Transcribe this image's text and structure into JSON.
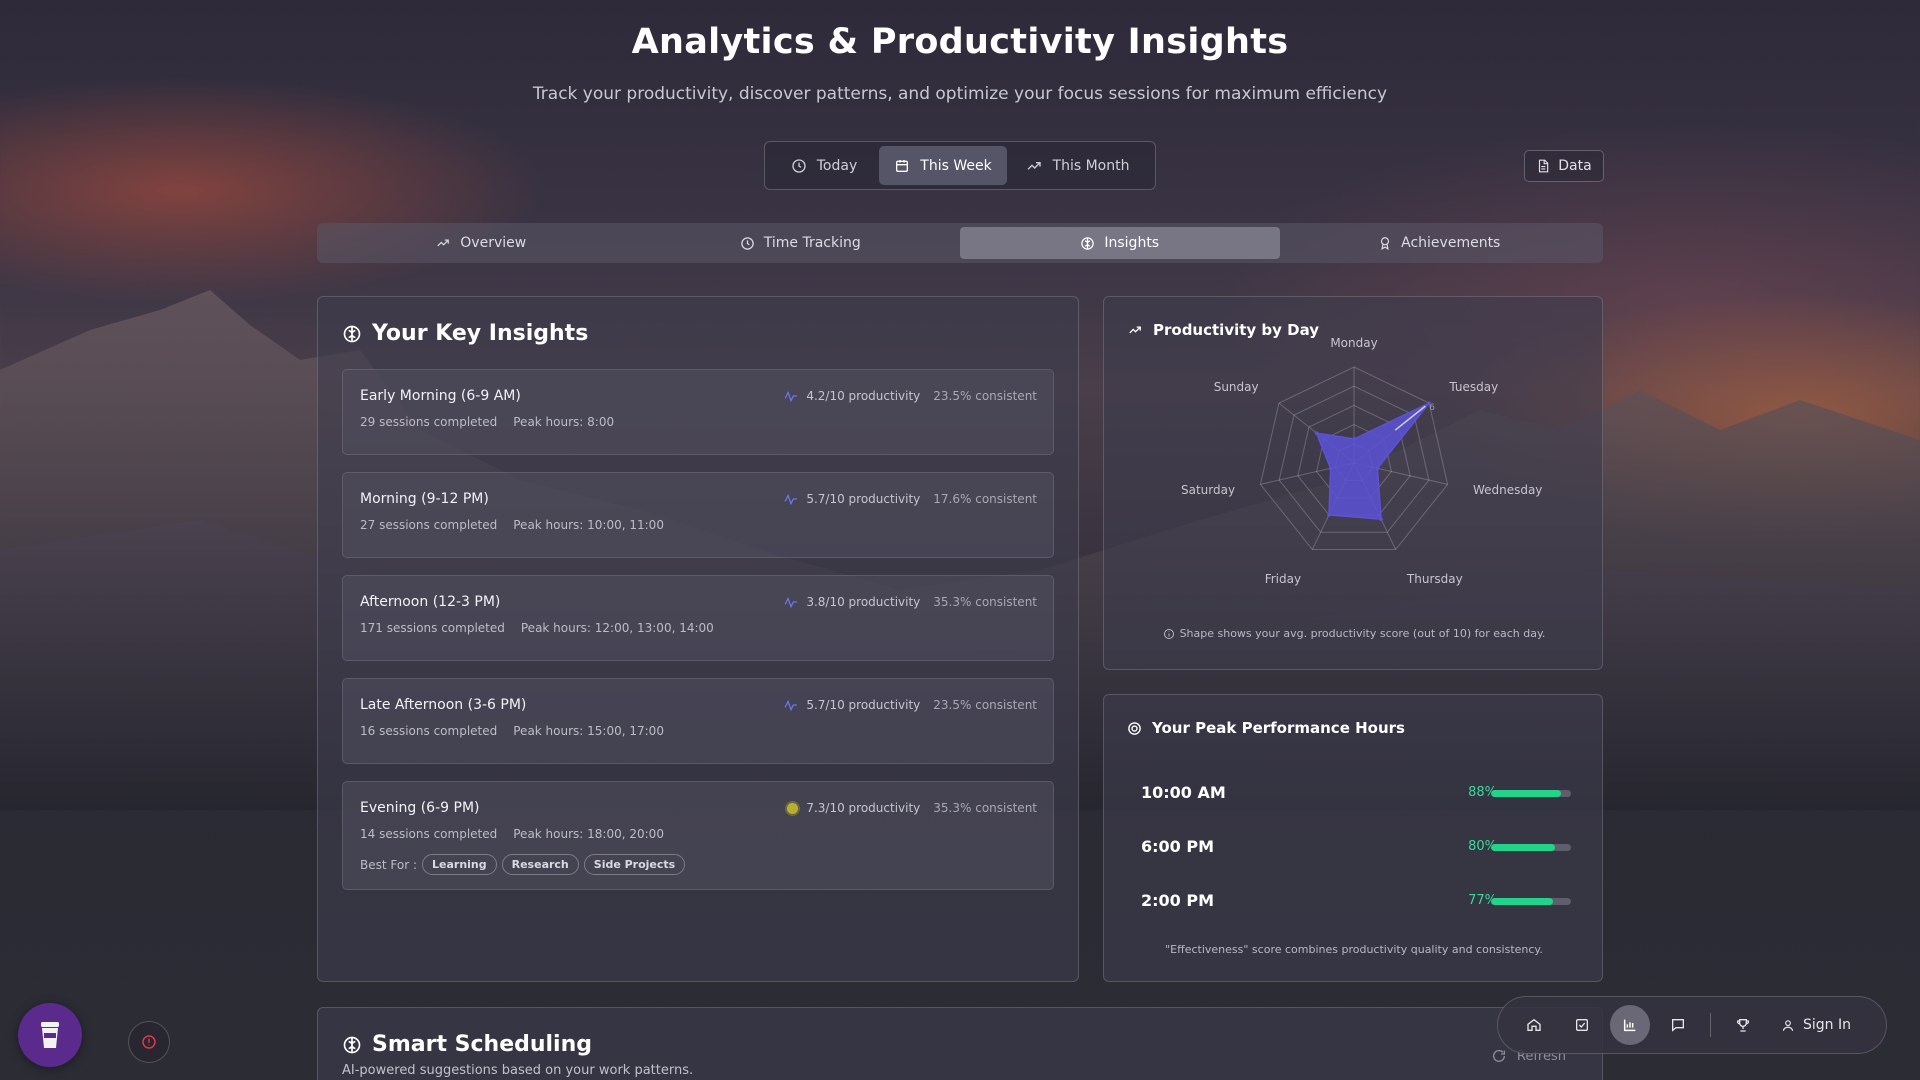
{
  "header": {
    "title": "Analytics & Productivity Insights",
    "subtitle": "Track your productivity, discover patterns, and optimize your focus sessions for maximum efficiency"
  },
  "range": {
    "options": [
      {
        "label": "Today",
        "icon": "clock-icon",
        "active": false
      },
      {
        "label": "This Week",
        "icon": "calendar-icon",
        "active": true
      },
      {
        "label": "This Month",
        "icon": "trending-up-icon",
        "active": false
      }
    ]
  },
  "data_button": {
    "label": "Data",
    "icon": "file-icon"
  },
  "tabs": [
    {
      "label": "Overview",
      "icon": "trending-up-icon",
      "active": false
    },
    {
      "label": "Time Tracking",
      "icon": "clock-icon",
      "active": false
    },
    {
      "label": "Insights",
      "icon": "brain-icon",
      "active": true
    },
    {
      "label": "Achievements",
      "icon": "award-icon",
      "active": false
    }
  ],
  "insights": {
    "title": "Your Key Insights",
    "slots": [
      {
        "name": "Early Morning (6-9 AM)",
        "sessions": "29 sessions completed",
        "peak": "Peak hours: 8:00",
        "productivity": "4.2/10 productivity",
        "consistency": "23.5% consistent",
        "icon": "activity-icon"
      },
      {
        "name": "Morning (9-12 PM)",
        "sessions": "27 sessions completed",
        "peak": "Peak hours: 10:00, 11:00",
        "productivity": "5.7/10 productivity",
        "consistency": "17.6% consistent",
        "icon": "activity-icon"
      },
      {
        "name": "Afternoon (12-3 PM)",
        "sessions": "171 sessions completed",
        "peak": "Peak hours: 12:00, 13:00, 14:00",
        "productivity": "3.8/10 productivity",
        "consistency": "35.3% consistent",
        "icon": "activity-icon"
      },
      {
        "name": "Late Afternoon (3-6 PM)",
        "sessions": "16 sessions completed",
        "peak": "Peak hours: 15:00, 17:00",
        "productivity": "5.7/10 productivity",
        "consistency": "23.5% consistent",
        "icon": "activity-icon"
      },
      {
        "name": "Evening (6-9 PM)",
        "sessions": "14 sessions completed",
        "peak": "Peak hours: 18:00, 20:00",
        "productivity": "7.3/10 productivity",
        "consistency": "35.3% consistent",
        "icon": "target-dot-icon",
        "best_for_label": "Best For :",
        "best_for": [
          "Learning",
          "Research",
          "Side Projects"
        ]
      }
    ]
  },
  "radar": {
    "title": "Productivity by Day",
    "note": "Shape shows your avg. productivity score (out of 10) for each day.",
    "days": [
      "Monday",
      "Tuesday",
      "Wednesday",
      "Thursday",
      "Friday",
      "Saturday",
      "Sunday"
    ],
    "scores": [
      2.5,
      10,
      2.5,
      6.5,
      6,
      2.5,
      5
    ],
    "max": 10,
    "tick_label": "6",
    "color": "#5b52d6"
  },
  "peak": {
    "title": "Your Peak Performance Hours",
    "rows": [
      {
        "time": "10:00 AM",
        "percent": "88%",
        "value": 0.88
      },
      {
        "time": "6:00 PM",
        "percent": "80%",
        "value": 0.8
      },
      {
        "time": "2:00 PM",
        "percent": "77%",
        "value": 0.77
      }
    ],
    "note": "\"Effectiveness\" score combines productivity quality and consistency."
  },
  "scheduling": {
    "title": "Smart Scheduling",
    "subtitle": "AI-powered suggestions based on your work patterns.",
    "refresh_label": "Refresh"
  },
  "dock": {
    "items": [
      "home-icon",
      "check-square-icon",
      "bar-chart-icon",
      "message-icon",
      "trophy-icon"
    ],
    "active": "bar-chart-icon",
    "signin_label": "Sign In"
  },
  "colors": {
    "accent_green": "#22d48a",
    "radar_fill": "#5b52d6",
    "fab_purple": "#5a2a8c"
  }
}
